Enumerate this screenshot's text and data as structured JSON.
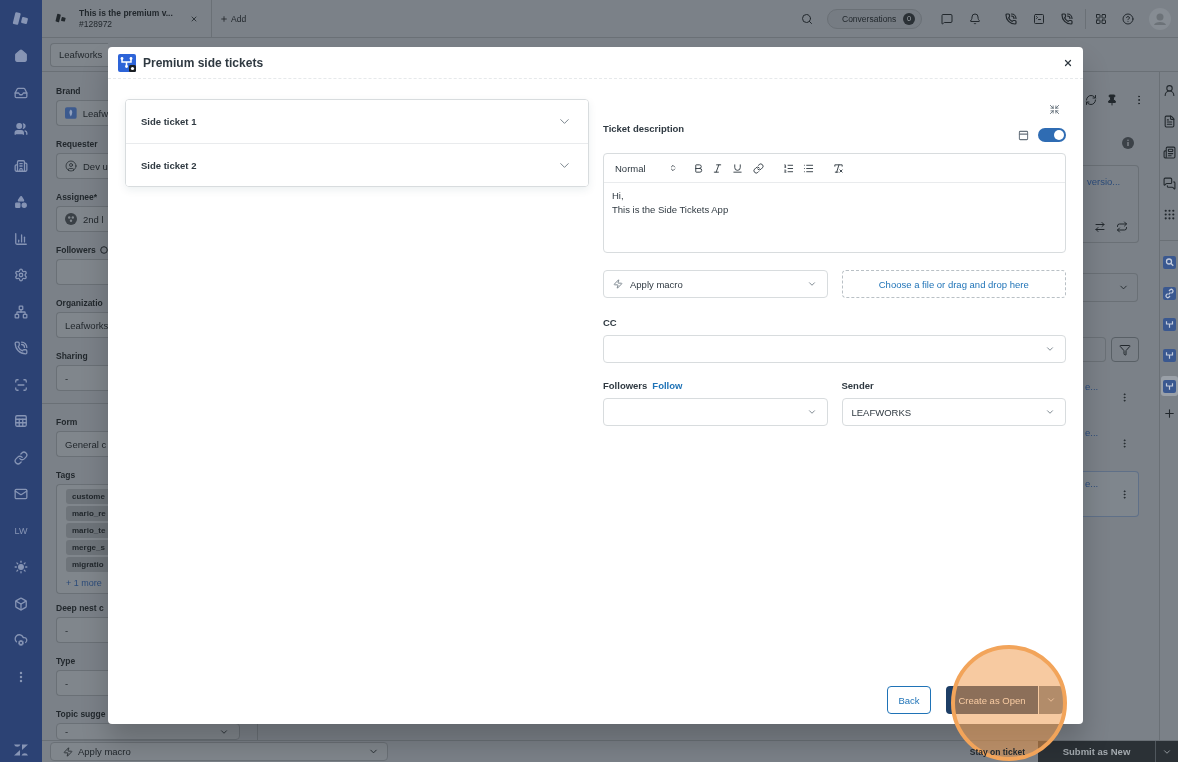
{
  "nav_rail": {
    "text_item": "LW"
  },
  "top_bar": {
    "ticket_tab": {
      "title": "This is the premium v...",
      "number": "#128972"
    },
    "add_label": "Add",
    "conversations": {
      "label": "Conversations",
      "count": "0"
    }
  },
  "sub_bar": {
    "workspace_tab": "Leafworks"
  },
  "properties": [
    {
      "label": "Brand",
      "kind": "brand",
      "value": "Leafw",
      "help_icon": false
    },
    {
      "label": "Requester",
      "kind": "user",
      "value": "Dev u",
      "help_icon": false
    },
    {
      "label": "Assignee*",
      "kind": "group",
      "value": "2nd l",
      "help_icon": false
    },
    {
      "label": "Followers",
      "kind": "empty",
      "help_icon": true
    },
    {
      "label": "Organizatio",
      "kind": "text",
      "value": "Leafworks",
      "help_icon": false
    },
    {
      "label": "Sharing",
      "kind": "text",
      "value": "-",
      "help_icon": false
    }
  ],
  "form_fields": [
    {
      "label": "Form",
      "kind": "text",
      "value": "General c"
    },
    {
      "label": "Tags",
      "kind": "tags",
      "tags": [
        "custome",
        "mario_re",
        "mario_te",
        "merge_s",
        "migratio"
      ],
      "more": "+ 1 more"
    },
    {
      "label": "Deep nest c",
      "kind": "text",
      "value": "-"
    },
    {
      "label": "Type",
      "kind": "text",
      "value": "-"
    },
    {
      "label": "Topic sugge",
      "kind": "select",
      "value": "-"
    }
  ],
  "context_panel": {
    "card_link": "versio...",
    "items": [
      {
        "text": "e...",
        "selected": false
      },
      {
        "text": "e...",
        "selected": false
      },
      {
        "text": "e...",
        "selected": true
      }
    ]
  },
  "app_rail": {
    "apps": [
      {
        "selected": false
      },
      {
        "selected": false
      },
      {
        "selected": false
      },
      {
        "selected": false
      },
      {
        "selected": true
      }
    ]
  },
  "bottom_bar": {
    "macro_placeholder": "Apply macro",
    "stay_label": "Stay on ticket",
    "submit_label": "Submit as New"
  },
  "modal": {
    "title": "Premium side tickets",
    "side_tickets": [
      {
        "title": "Side ticket 1",
        "expanded": false
      },
      {
        "title": "Side ticket 2",
        "expanded": false
      }
    ],
    "description": {
      "label": "Ticket description",
      "toggle_on": true,
      "format": "Normal",
      "lines": [
        "Hi,",
        "This is the Side Tickets App"
      ]
    },
    "macro_placeholder": "Apply macro",
    "attachment_text": "Choose a file or drag and drop here",
    "cc": {
      "label": "CC"
    },
    "followers": {
      "label": "Followers",
      "link": "Follow"
    },
    "sender": {
      "label": "Sender",
      "value": "LEAFWORKS"
    },
    "back_label": "Back",
    "primary_label": "Create as Open"
  },
  "highlight_ring": true
}
